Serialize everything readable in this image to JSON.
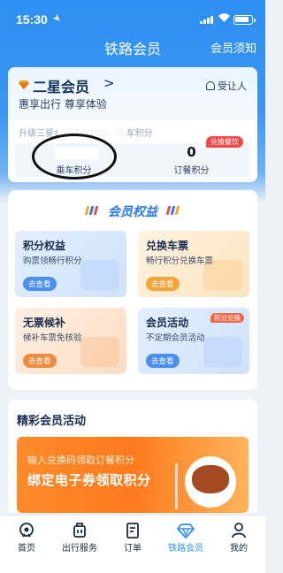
{
  "status_bar": {
    "time": "15:30"
  },
  "nav": {
    "title": "铁路会员",
    "right_link": "会员须知"
  },
  "member_card": {
    "level": "二星会员",
    "level_arrow": ">",
    "tagline": "惠享出行 尊享体验",
    "beneficiary": "受让人",
    "upgrade_text": "升级三星会员还需10000乘车积分",
    "ride_points_label": "乘车积分",
    "meal_points_value": "0",
    "meal_points_label": "订餐积分",
    "meal_badge": "兑换餐饮"
  },
  "benefits": {
    "title": "会员权益",
    "tiles": [
      {
        "title": "积分权益",
        "subtitle": "购票领畅行积分",
        "button": "去查看",
        "tag": ""
      },
      {
        "title": "兑换车票",
        "subtitle": "畅行积分兑换车票",
        "button": "去查看",
        "tag": ""
      },
      {
        "title": "无票候补",
        "subtitle": "候补车票免核验",
        "button": "去查看",
        "tag": ""
      },
      {
        "title": "会员活动",
        "subtitle": "不定期会员活动",
        "button": "去查看",
        "tag": "积分兑换"
      }
    ]
  },
  "activities": {
    "title": "精彩会员活动",
    "banner_line1": "输入兑换码领取订餐积分",
    "banner_line2": "绑定电子券领取积分"
  },
  "tab_bar": {
    "items": [
      {
        "label": "首页",
        "icon": "train-icon"
      },
      {
        "label": "出行服务",
        "icon": "luggage-icon"
      },
      {
        "label": "订单",
        "icon": "order-icon"
      },
      {
        "label": "铁路会员",
        "icon": "diamond-icon"
      },
      {
        "label": "我的",
        "icon": "user-icon"
      }
    ],
    "active_index": 3
  },
  "colors": {
    "primary": "#2d8ff2",
    "badge_red": "#f04a4a",
    "banner_orange": "#ff7a1c"
  }
}
